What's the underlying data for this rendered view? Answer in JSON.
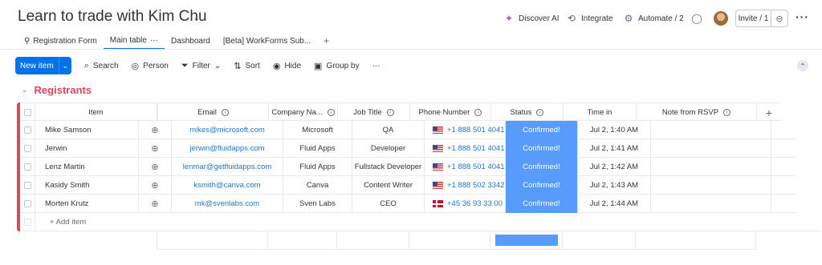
{
  "board": {
    "title": "Learn to trade with Kim Chu",
    "title_chevron": "⌄",
    "actions": [
      {
        "icon": "sparkle-icon",
        "glyph": "✦",
        "label": "Discover AI"
      },
      {
        "icon": "integrate-icon",
        "glyph": "⟲",
        "label": "Integrate"
      },
      {
        "icon": "robot-icon",
        "glyph": "⚙",
        "label": "Automate / 2"
      }
    ],
    "invite_label": "Invite / 1",
    "link_glyph": "⊖",
    "chat_glyph": "◯",
    "more_glyph": "···"
  },
  "tabs": [
    {
      "label": "Registration Form",
      "prefix": "⚲"
    },
    {
      "label": "Main table",
      "suffix": "···"
    },
    {
      "label": "Dashboard"
    },
    {
      "label": "[Beta] WorkForms Sub..."
    }
  ],
  "tab_add": "+",
  "toolbar": {
    "new_item": "New item",
    "caret": "⌄",
    "search": "Search",
    "person": "Person",
    "filter": "Filter",
    "filter_caret": "⌄",
    "sort": "Sort",
    "hide": "Hide",
    "group_by": "Group by",
    "more": "···",
    "collapse": "⌃"
  },
  "group": {
    "name": "Registrants",
    "chevron": "⌄",
    "color": "#e2445c"
  },
  "columns": {
    "item": "Item",
    "email": "Email",
    "company": "Company Na...",
    "job": "Job Title",
    "phone": "Phone Number",
    "status": "Status",
    "time": "Time in",
    "note": "Note from RSVP",
    "add": "+"
  },
  "rows": [
    {
      "item": "Mike Samson",
      "email": "mikes@microsoft.com",
      "company": "Microsoft",
      "job": "QA",
      "flag": "us",
      "phone": "+1 888 501 4041",
      "status": "Confirmed!",
      "time": "Jul 2, 1:40 AM",
      "note": ""
    },
    {
      "item": "Jerwin",
      "email": "jerwin@fluidapps.com",
      "company": "Fluid Apps",
      "job": "Developer",
      "flag": "us",
      "phone": "+1 888 501 4041",
      "status": "Confirmed!",
      "time": "Jul 2, 1:41 AM",
      "note": ""
    },
    {
      "item": "Lenz Martin",
      "email": "lenmar@getfluidapps.com",
      "company": "Fluid Apps",
      "job": "Fullstack Developer",
      "flag": "us",
      "phone": "+1 888 501 4041",
      "status": "Confirmed!",
      "time": "Jul 2, 1:42 AM",
      "note": ""
    },
    {
      "item": "Kasidy Smith",
      "email": "ksmith@canva.com",
      "company": "Canva",
      "job": "Content Writer",
      "flag": "us",
      "phone": "+1 888 502 3342",
      "status": "Confirmed!",
      "time": "Jul 2, 1:43 AM",
      "note": ""
    },
    {
      "item": "Morten Krutz",
      "email": "mk@svenlabs.com",
      "company": "Sven Labs",
      "job": "CEO",
      "flag": "dk",
      "phone": "+45 36 93 33 00",
      "status": "Confirmed!",
      "time": "Jul 2, 1:44 AM",
      "note": ""
    }
  ],
  "add_item": "+ Add item",
  "colors": {
    "primary": "#0073ea",
    "status_confirmed": "#579bfc",
    "group": "#e2445c",
    "link": "#1f76c2"
  }
}
